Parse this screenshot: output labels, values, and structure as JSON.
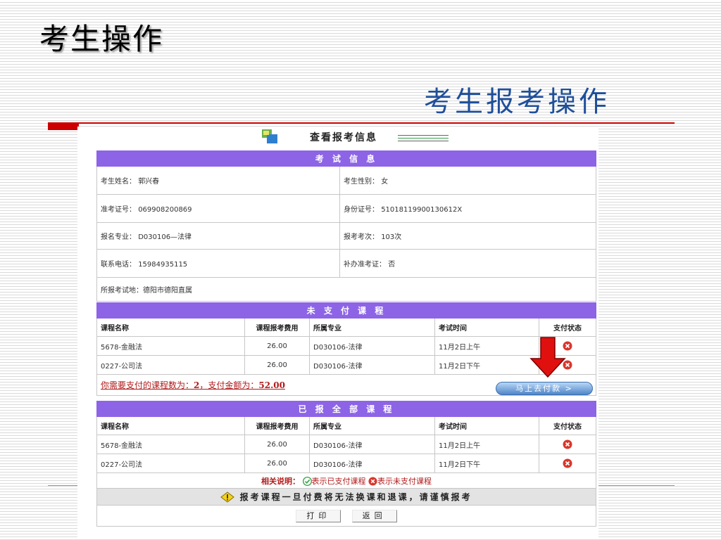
{
  "slide": {
    "title": "考生操作",
    "subtitle": "考生报考操作"
  },
  "panel": {
    "header_title": "查看报考信息",
    "exam_info": {
      "section_title": "考 试 信 息",
      "name_label": "考生姓名：",
      "name": "郭兴春",
      "gender_label": "考生性别：",
      "gender": "女",
      "ticket_label": "准考证号：",
      "ticket": "069908200869",
      "id_label": "身份证号：",
      "id_number": "510181199001306​12X",
      "major_label": "报名专业：",
      "major": "D030106—法律",
      "attempts_label": "报考考次：",
      "attempts": "103次",
      "phone_label": "联系电话：",
      "phone": "15984935115",
      "reissue_label": "补办准考证：",
      "reissue": "否",
      "location_label": "所报考试地：",
      "location": "德阳市德阳直属"
    },
    "columns": [
      "课程名称",
      "课程报考费用",
      "所属专业",
      "考试时间",
      "支付状态"
    ],
    "unpaid": {
      "section_title": "未 支 付 课 程",
      "rows": [
        {
          "course": "5678-金融法",
          "fee": "26.00",
          "major": "D030106-法律",
          "time": "11月2日上午"
        },
        {
          "course": "0227-公司法",
          "fee": "26.00",
          "major": "D030106-法律",
          "time": "11月2日下午"
        }
      ],
      "summary_prefix": "你需要支付的课程数为：",
      "count": "2",
      "summary_mid": "，支付金额为：",
      "amount": "52.00",
      "pay_button": "马上去付款 >"
    },
    "registered": {
      "section_title": "已 报 全 部 课 程",
      "rows": [
        {
          "course": "5678-金融法",
          "fee": "26.00",
          "major": "D030106-法律",
          "time": "11月2日上午"
        },
        {
          "course": "0227-公司法",
          "fee": "26.00",
          "major": "D030106-法律",
          "time": "11月2日下午"
        }
      ]
    },
    "notes": {
      "label": "相关说明：",
      "paid_text": "表示已支付课程",
      "unpaid_text": "表示未支付课程"
    },
    "warning": "报考课程一旦付费将无法换课和退课，请谨慎报考",
    "buttons": {
      "print": "打印",
      "back": "返回"
    }
  },
  "colors": {
    "section_header": "#8d64e6",
    "accent_red": "#cc0000",
    "subtitle_blue": "#1f4f9a"
  },
  "icons": [
    "info-icon",
    "unpaid-x-icon",
    "paid-check-icon",
    "warning-icon",
    "down-arrow-icon"
  ]
}
